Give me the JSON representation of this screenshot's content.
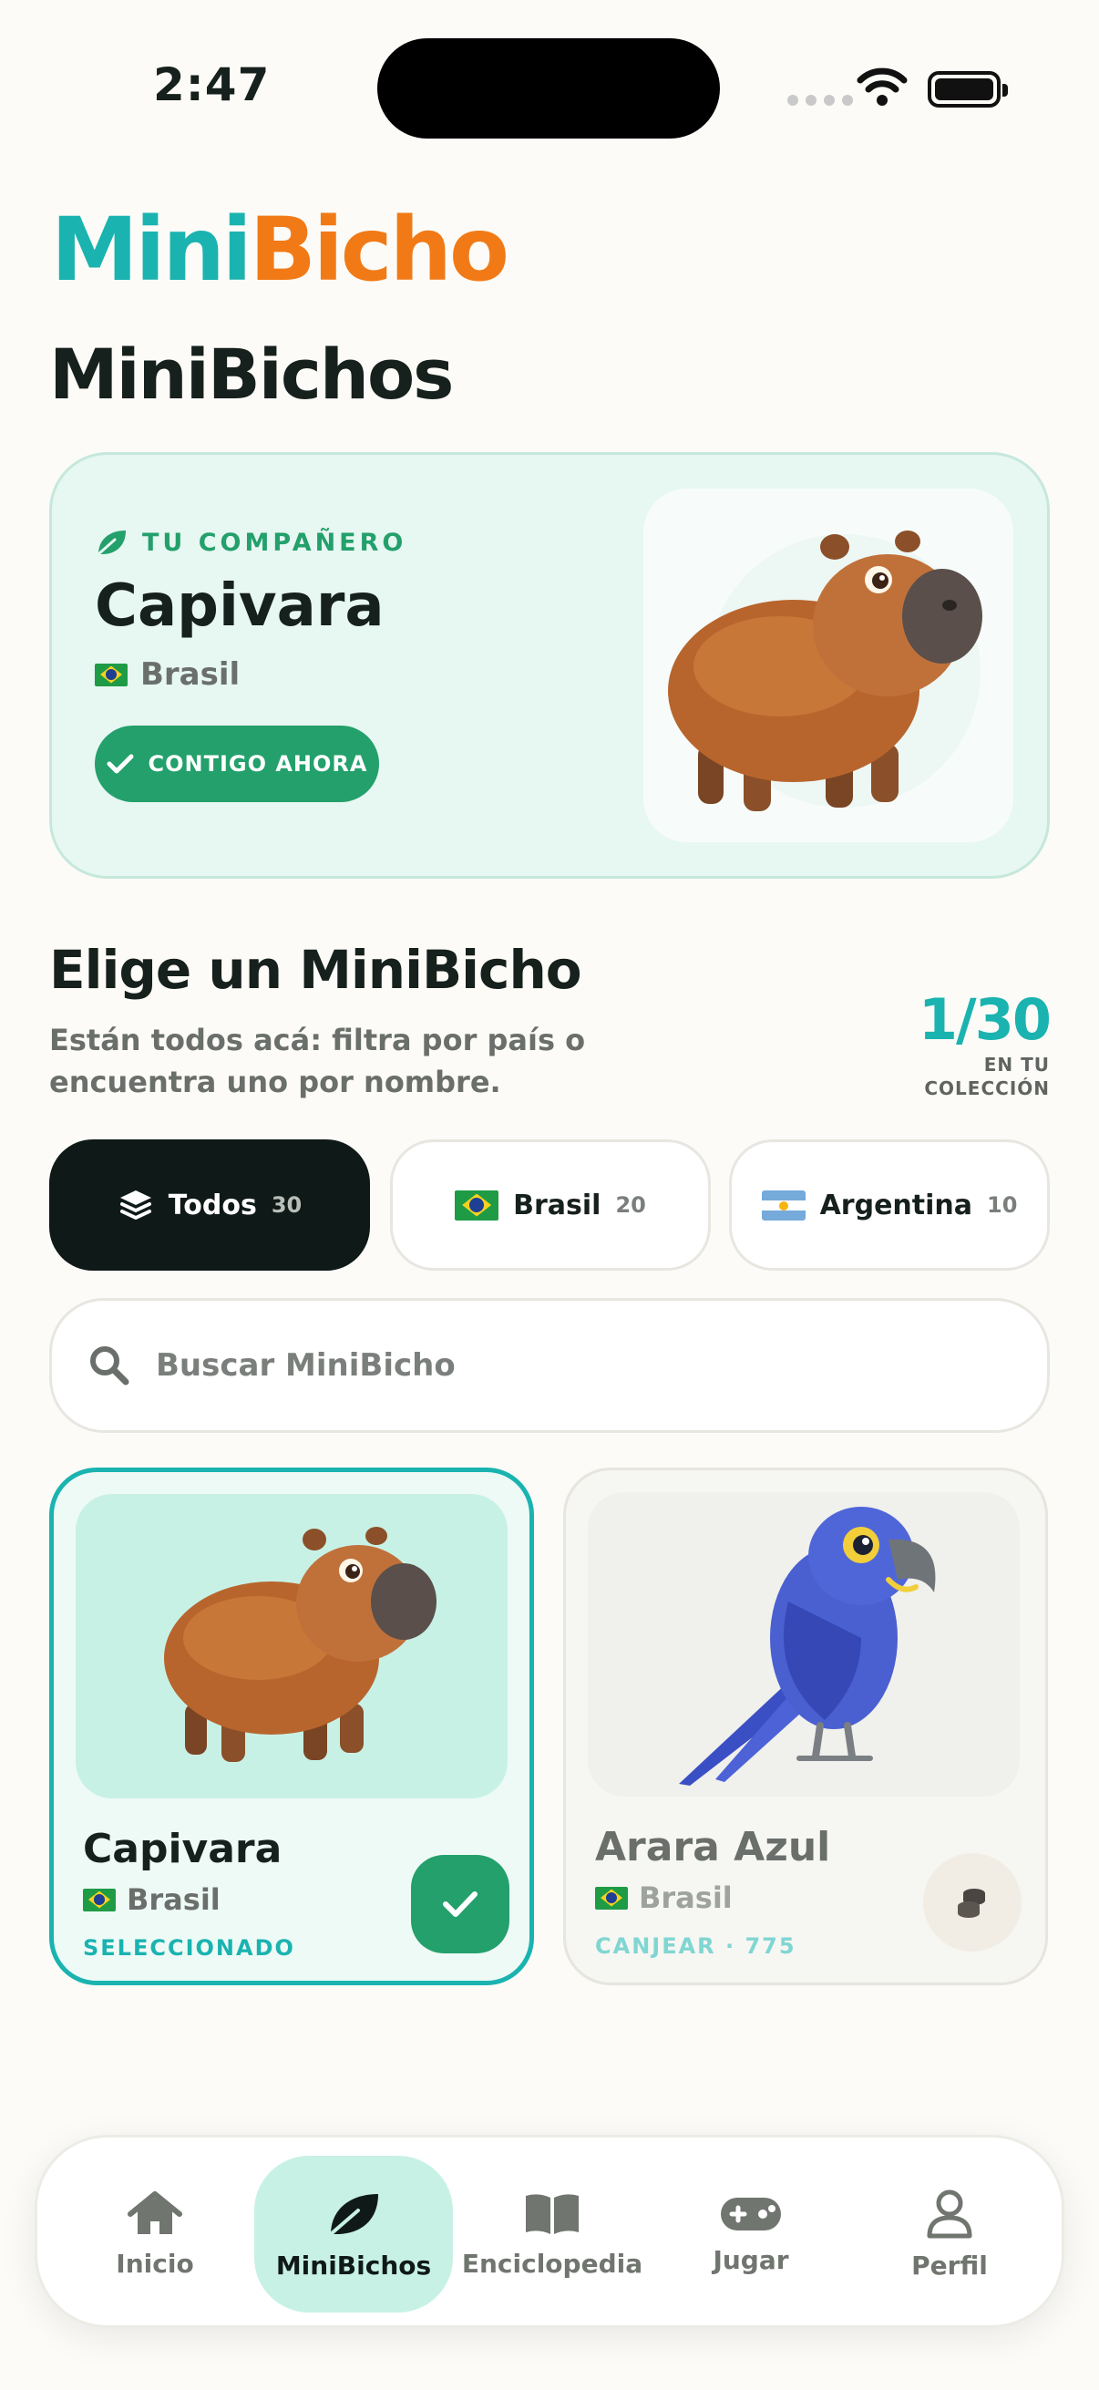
{
  "status_bar": {
    "time": "2:47"
  },
  "logo": {
    "part1": "Mini",
    "part2": "Bicho"
  },
  "page_title": "MiniBichos",
  "companion": {
    "label": "TU COMPAÑERO",
    "name": "Capivara",
    "country": "Brasil",
    "button": "CONTIGO AHORA"
  },
  "choose": {
    "title": "Elige un MiniBicho",
    "subtitle": "Están todos acá: filtra por país o encuentra uno por nombre.",
    "count": "1/30",
    "count_label": "EN TU COLECCIÓN"
  },
  "filters": [
    {
      "label": "Todos",
      "count": "30",
      "selected": true
    },
    {
      "label": "Brasil",
      "count": "20",
      "selected": false
    },
    {
      "label": "Argentina",
      "count": "10",
      "selected": false
    }
  ],
  "search": {
    "placeholder": "Buscar MiniBicho",
    "value": ""
  },
  "cards": [
    {
      "name": "Capivara",
      "country": "Brasil",
      "status": "SELECCIONADO",
      "selected": true
    },
    {
      "name": "Arara Azul",
      "country": "Brasil",
      "status": "CANJEAR · 775",
      "selected": false
    }
  ],
  "nav": [
    {
      "label": "Inicio",
      "icon": "home-icon",
      "active": false
    },
    {
      "label": "MiniBichos",
      "icon": "leaf-icon",
      "active": true
    },
    {
      "label": "Enciclopedia",
      "icon": "book-icon",
      "active": false
    },
    {
      "label": "Jugar",
      "icon": "gamepad-icon",
      "active": false
    },
    {
      "label": "Perfil",
      "icon": "person-icon",
      "active": false
    }
  ],
  "colors": {
    "accent_teal": "#1ab3b0",
    "accent_orange": "#f17a17",
    "accent_green": "#23a06b",
    "dark": "#0f1a18",
    "background": "#fcfbf7"
  }
}
